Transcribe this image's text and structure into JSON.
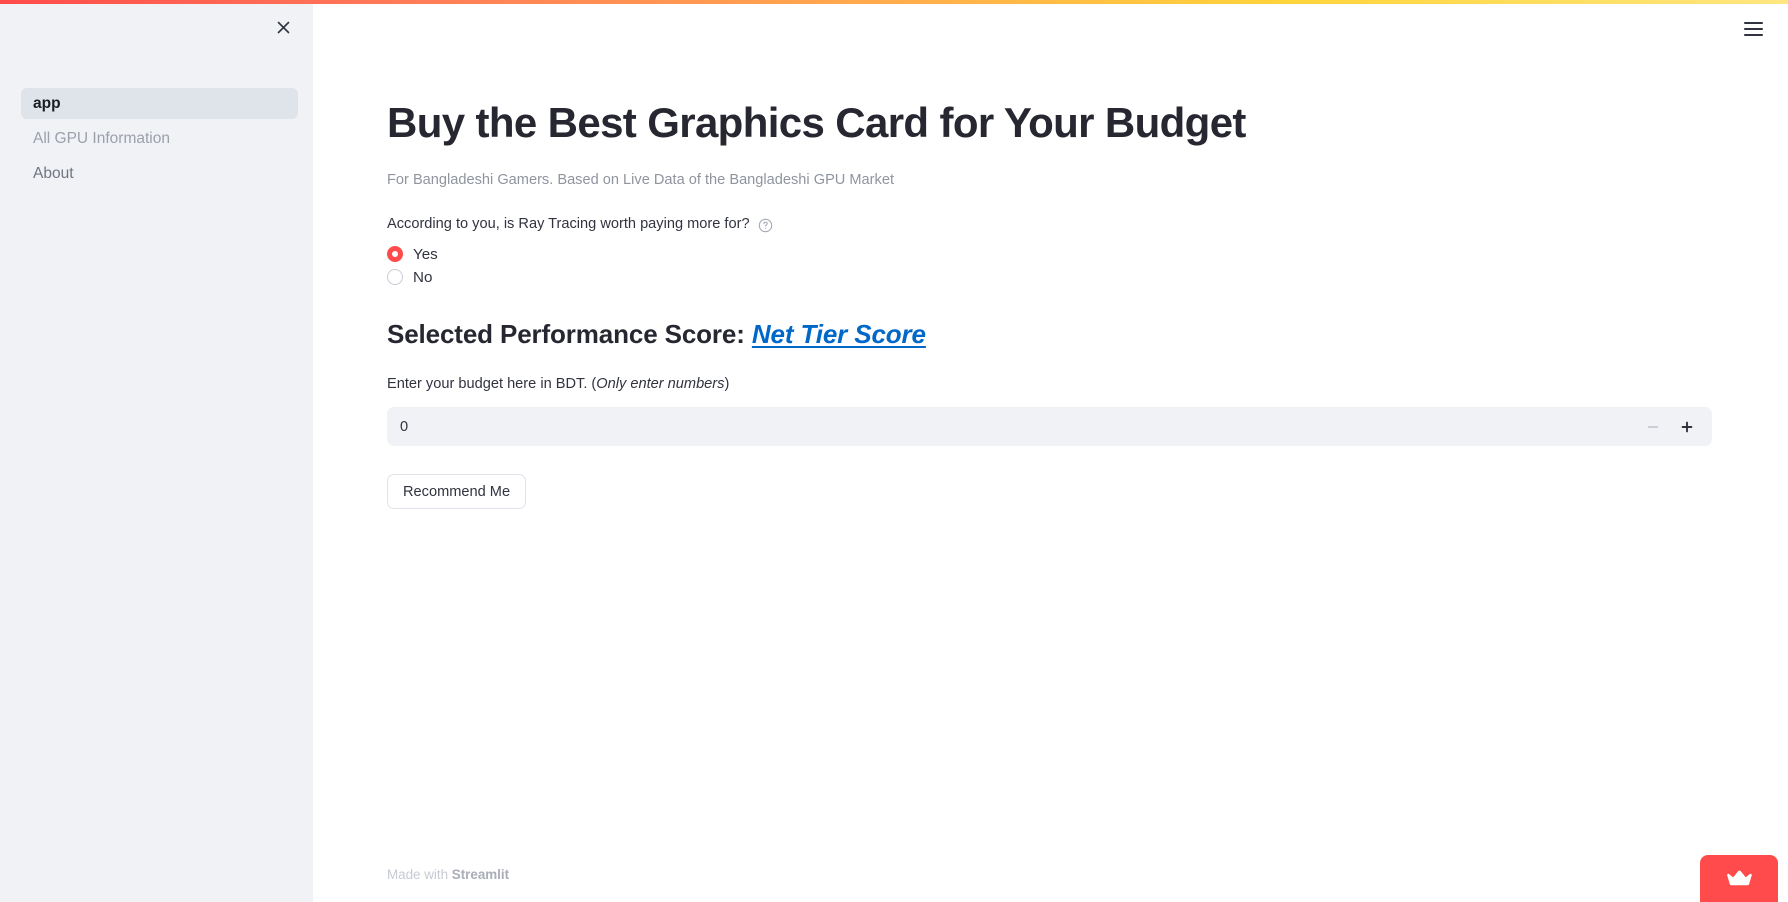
{
  "window": {
    "accent_color": "#ff4b4b",
    "link_color": "#0068c9",
    "sidebar_bg": "#f0f2f6"
  },
  "sidebar": {
    "close_icon": "close-icon",
    "items": [
      {
        "label": "app",
        "active": true
      },
      {
        "label": "All GPU Information",
        "active": false
      },
      {
        "label": "About",
        "active": false
      }
    ]
  },
  "header": {
    "menu_icon": "hamburger-menu-icon"
  },
  "main": {
    "title": "Buy the Best Graphics Card for Your Budget",
    "subtitle": "For Bangladeshi Gamers. Based on Live Data of the Bangladeshi GPU Market",
    "question": {
      "label": "According to you, is Ray Tracing worth paying more for?",
      "help_icon": "help-circle-icon",
      "options": [
        {
          "label": "Yes",
          "selected": true
        },
        {
          "label": "No",
          "selected": false
        }
      ]
    },
    "score_section": {
      "heading_prefix": "Selected Performance Score:",
      "score_link": "Net Tier Score"
    },
    "budget": {
      "label_plain": "Enter your budget here in BDT. (",
      "label_italic": "Only enter numbers",
      "label_close": ")",
      "value": "0",
      "decrement_icon": "minus-icon",
      "increment_icon": "plus-icon"
    },
    "submit_button": "Recommend Me"
  },
  "footer": {
    "made_with": "Made with",
    "brand": "Streamlit",
    "manage_badge_icon": "crown-icon"
  }
}
